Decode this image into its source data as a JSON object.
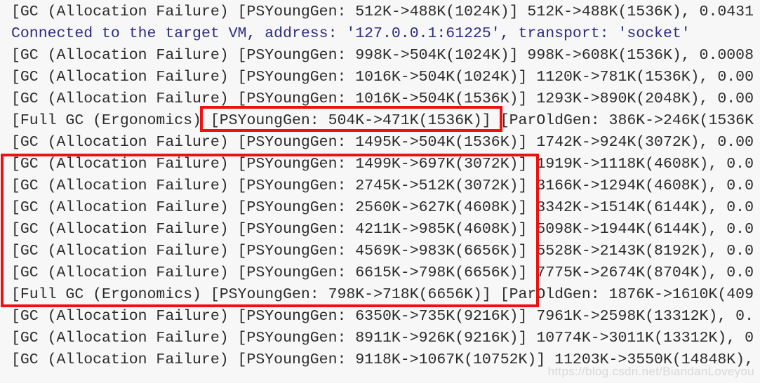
{
  "console": {
    "background_color": "#f7f7f7",
    "default_text_color": "#2b2b2b",
    "info_text_color": "#2c2c80",
    "annotation_color": "#ee1111",
    "lines": [
      {
        "text": "[GC (Allocation Failure) [PSYoungGen: 512K->488K(1024K)] 512K->488K(1536K), 0.0431",
        "type": "gc"
      },
      {
        "text": "Connected to the target VM, address: '127.0.0.1:61225', transport: 'socket'",
        "type": "info"
      },
      {
        "text": "[GC (Allocation Failure) [PSYoungGen: 998K->504K(1024K)] 998K->608K(1536K), 0.0008",
        "type": "gc"
      },
      {
        "text": "[GC (Allocation Failure) [PSYoungGen: 1016K->504K(1024K)] 1120K->781K(1536K), 0.00",
        "type": "gc"
      },
      {
        "text": "[GC (Allocation Failure) [PSYoungGen: 1016K->504K(1536K)] 1293K->890K(2048K), 0.00",
        "type": "gc"
      },
      {
        "text": "[Full GC (Ergonomics) [PSYoungGen: 504K->471K(1536K)] [ParOldGen: 386K->246K(1536K",
        "type": "full-gc"
      },
      {
        "text": "[GC (Allocation Failure) [PSYoungGen: 1495K->504K(1536K)] 1742K->924K(3072K), 0.00",
        "type": "gc"
      },
      {
        "text": "[GC (Allocation Failure) [PSYoungGen: 1499K->697K(3072K)] 1919K->1118K(4608K), 0.0",
        "type": "gc"
      },
      {
        "text": "[GC (Allocation Failure) [PSYoungGen: 2745K->512K(3072K)] 3166K->1294K(4608K), 0.0",
        "type": "gc"
      },
      {
        "text": "[GC (Allocation Failure) [PSYoungGen: 2560K->627K(4608K)] 3342K->1514K(6144K), 0.0",
        "type": "gc"
      },
      {
        "text": "[GC (Allocation Failure) [PSYoungGen: 4211K->985K(4608K)] 5098K->1944K(6144K), 0.0",
        "type": "gc"
      },
      {
        "text": "[GC (Allocation Failure) [PSYoungGen: 4569K->983K(6656K)] 5528K->2143K(8192K), 0.0",
        "type": "gc"
      },
      {
        "text": "[GC (Allocation Failure) [PSYoungGen: 6615K->798K(6656K)] 7775K->2674K(8704K), 0.0",
        "type": "gc"
      },
      {
        "text": "[Full GC (Ergonomics) [PSYoungGen: 798K->718K(6656K)] [ParOldGen: 1876K->1610K(409",
        "type": "full-gc"
      },
      {
        "text": "[GC (Allocation Failure) [PSYoungGen: 6350K->735K(9216K)] 7961K->2598K(13312K), 0.",
        "type": "gc"
      },
      {
        "text": "[GC (Allocation Failure) [PSYoungGen: 8911K->926K(9216K)] 10774K->3011K(13312K), 0",
        "type": "gc"
      },
      {
        "text": "[GC (Allocation Failure) [PSYoungGen: 9118K->1067K(10752K)] 11203K->3550K(14848K),",
        "type": "gc"
      }
    ]
  },
  "annotations": [
    {
      "id": "annot-box-1",
      "label": "full-gc-young-gen-highlight",
      "highlights": "[PSYoungGen: 504K->471K(1536K)]"
    },
    {
      "id": "annot-box-2",
      "label": "young-gen-growth-block-highlight",
      "highlights": "GC allocation failure lines 1499K->697K(3072K) through Full GC 798K->718K(6656K)"
    }
  ],
  "watermark": {
    "text": "https://blog.csdn.net/BiandanLoveyou"
  }
}
